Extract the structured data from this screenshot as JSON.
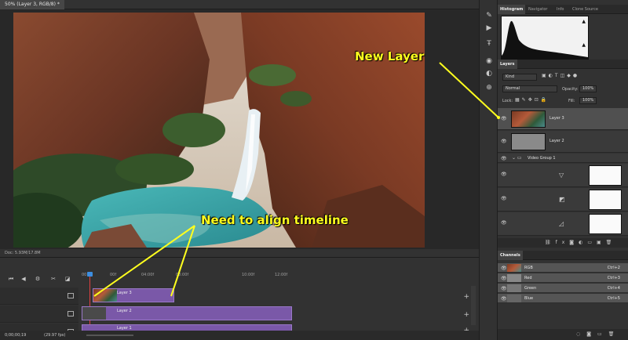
{
  "document": {
    "tab_title": "50% (Layer 3, RGB/8) *",
    "status": "Doc: 5.93M/17.8M"
  },
  "annotations": {
    "new_layer": "New Layer",
    "align_timeline": "Need to align timeline"
  },
  "timeline": {
    "ruler_ticks": [
      "00",
      "00f",
      "04:00f",
      "08:00f",
      "10:00f",
      "12:00f"
    ],
    "tracks": [
      {
        "name": "Layer 3"
      },
      {
        "name": "Layer 2"
      },
      {
        "name": "Layer 1"
      }
    ],
    "timecode": "0;00;00;19",
    "fps": "(29.97 fps)"
  },
  "panels": {
    "top_tabs": [
      "Histogram",
      "Navigator",
      "Info",
      "Clone Source"
    ],
    "layers_tab": "Layers",
    "filter_kind": "Kind",
    "blend_mode": "Normal",
    "opacity_label": "Opacity:",
    "opacity_value": "100%",
    "lock_label": "Lock:",
    "fill_label": "Fill:",
    "fill_value": "100%",
    "layers": [
      {
        "name": "Layer 3"
      },
      {
        "name": "Layer 2"
      }
    ],
    "group_name": "Video Group 1",
    "channels_tab": "Channels",
    "channels": [
      {
        "name": "RGB",
        "shortcut": "Ctrl+2"
      },
      {
        "name": "Red",
        "shortcut": "Ctrl+3"
      },
      {
        "name": "Green",
        "shortcut": "Ctrl+4"
      },
      {
        "name": "Blue",
        "shortcut": "Ctrl+5"
      }
    ]
  },
  "colors": {
    "annotation": "#ffff1e",
    "clip": "#7a58a8",
    "panel_bg": "#323232"
  }
}
